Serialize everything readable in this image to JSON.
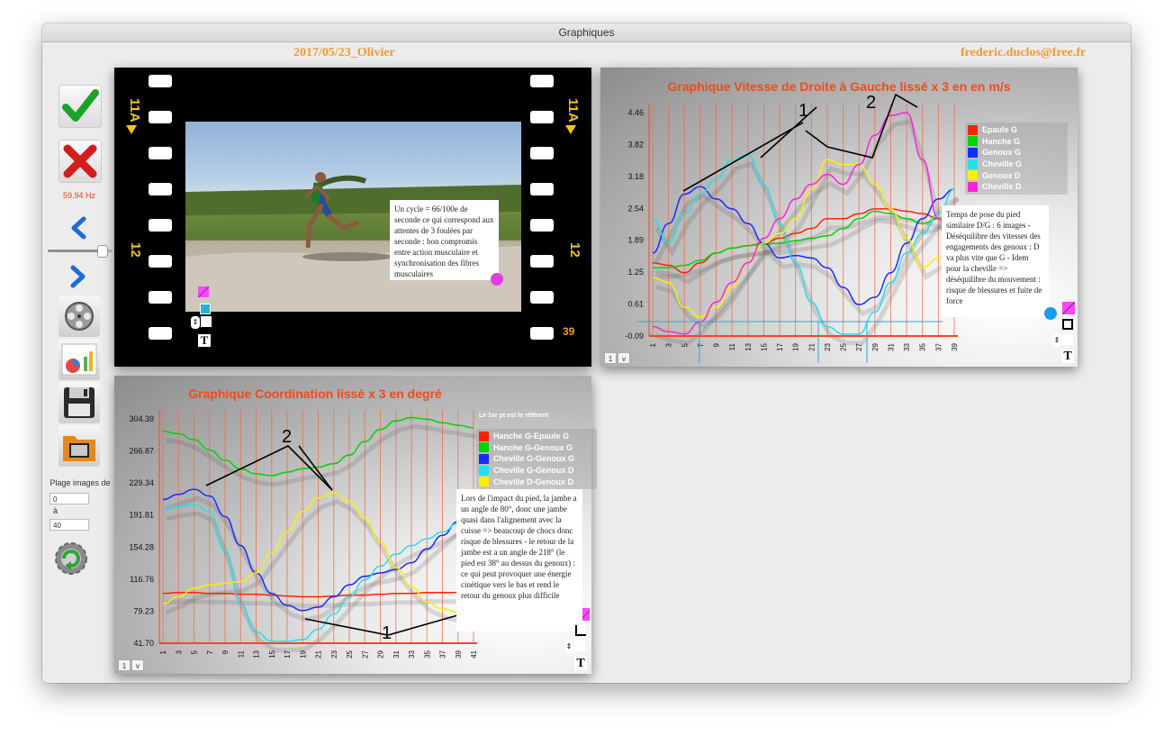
{
  "window": {
    "title": "Graphiques"
  },
  "header": {
    "left": "2017/05/23_Olivier",
    "right": "frederic.duclos@free.fr"
  },
  "sidebar": {
    "validate_icon": "checkmark-icon",
    "cancel_icon": "cross-icon",
    "frequency": "59.94 Hz",
    "slider_level": 0.9,
    "range_label": "Plage images de",
    "range_from": "0",
    "range_to_label": "à",
    "range_to": "40"
  },
  "video": {
    "film_code": "11A",
    "film_number": "12",
    "frame_number": "39",
    "note": "Un cycle = 66/100e de seconde ce qui correspond aux attentes de 3 foulées par seconde : bon compromis entre action musculaire et synchronisation des fibres musculaires"
  },
  "speed_panel": {
    "note": "Temps de pose du pied similaire D/G : 6 images -  Déséquilibre des vitesses des engagements des genoux : D va plus vite  que G -  Idem pour la cheville => déséquilibre du mouvement : risque de blessures et fuite de force",
    "annotations": [
      "1",
      "2"
    ],
    "btn1": "1",
    "btn2": "v"
  },
  "coord_panel": {
    "legend_header": "Le 1er pt est le référent",
    "note": "Lors de l'impact du pied, la jambe a un angle de 80°, donc une jambe quasi dans l'alignement avec la cuisse => beaucoup de chocs donc risque de blessures  -  le retour de la jambe est a un angle de 218° (le pied est 38° au dessus du genoux) : ce qui peut provoquer une énergie cinétique vers le bas et rend le retour du genoux plus difficile",
    "annotations": [
      "2",
      "1"
    ],
    "btn1": "1",
    "btn2": "v"
  },
  "chart_data": [
    {
      "type": "line",
      "title": "Graphique Vitesse de Droite à Gauche lissé x 3 en  en m/s",
      "x": [
        1,
        3,
        5,
        7,
        9,
        11,
        13,
        15,
        17,
        19,
        21,
        23,
        25,
        27,
        29,
        31,
        33,
        35,
        37,
        39
      ],
      "y_ticks": [
        "4.46",
        "3.82",
        "3.18",
        "2.54",
        "1.89",
        "1.25",
        "0.61",
        "-0.09"
      ],
      "ylim": [
        -0.09,
        4.46
      ],
      "series": [
        {
          "name": "Epaule G",
          "color": "#ff2200",
          "values": [
            1.4,
            1.35,
            1.2,
            1.4,
            1.6,
            1.7,
            1.75,
            1.8,
            1.9,
            2.0,
            2.1,
            2.3,
            2.3,
            2.4,
            2.5,
            2.5,
            2.45,
            2.4,
            2.3,
            2.5
          ]
        },
        {
          "name": "Hanche G",
          "color": "#00d400",
          "values": [
            1.3,
            1.3,
            1.35,
            1.45,
            1.6,
            1.7,
            1.75,
            1.78,
            1.8,
            1.85,
            1.9,
            1.95,
            2.1,
            2.3,
            2.45,
            2.4,
            2.3,
            2.2,
            2.3,
            2.5
          ]
        },
        {
          "name": "Genoux G",
          "color": "#1a2bff",
          "values": [
            1.6,
            2.2,
            2.8,
            2.95,
            2.7,
            2.5,
            2.2,
            1.8,
            1.5,
            1.55,
            1.5,
            1.3,
            0.9,
            0.55,
            0.7,
            1.2,
            1.8,
            2.3,
            2.7,
            2.9
          ]
        },
        {
          "name": "Cheville G",
          "color": "#22e0f0",
          "values": [
            2.3,
            1.8,
            2.4,
            2.8,
            3.1,
            3.5,
            3.6,
            3.0,
            2.2,
            1.4,
            0.6,
            0.1,
            -0.05,
            -0.05,
            0.4,
            1.0,
            1.6,
            2.0,
            2.4,
            2.9
          ]
        },
        {
          "name": "Genoux D",
          "color": "#ffee00",
          "values": [
            1.1,
            1.0,
            0.5,
            0.3,
            0.5,
            0.9,
            1.4,
            1.8,
            2.0,
            2.3,
            2.9,
            3.5,
            3.4,
            3.4,
            3.0,
            2.5,
            1.9,
            1.3,
            1.5,
            1.9
          ]
        },
        {
          "name": "Cheville D",
          "color": "#ff22dd",
          "values": [
            0.1,
            0.0,
            -0.05,
            0.2,
            0.6,
            1.0,
            1.4,
            1.9,
            2.3,
            2.7,
            3.0,
            3.2,
            3.0,
            3.4,
            4.0,
            4.4,
            4.46,
            3.5,
            2.3,
            1.5
          ]
        }
      ]
    },
    {
      "type": "line",
      "title": "Graphique Coordination lissé x 3 en degré",
      "x": [
        1,
        3,
        5,
        7,
        9,
        11,
        13,
        15,
        17,
        19,
        21,
        23,
        25,
        27,
        29,
        31,
        33,
        35,
        37,
        39,
        41
      ],
      "y_ticks": [
        "304.39",
        "266.87",
        "229.34",
        "191.81",
        "154.28",
        "116.76",
        "79.23",
        "41.70"
      ],
      "ylim": [
        41.7,
        304.39
      ],
      "series": [
        {
          "name": "Hanche G-Epaule G",
          "color": "#ff2200",
          "values": [
            100,
            101,
            101,
            100,
            100,
            99,
            99,
            98,
            97,
            96,
            96,
            97,
            98,
            98,
            99,
            100,
            100,
            101,
            101,
            101,
            101
          ]
        },
        {
          "name": "Hanche G-Genoux G",
          "color": "#00d400",
          "values": [
            290,
            287,
            280,
            268,
            256,
            246,
            240,
            238,
            242,
            246,
            248,
            252,
            262,
            278,
            292,
            302,
            306,
            304,
            300,
            297,
            294
          ]
        },
        {
          "name": "Cheville G-Genoux G",
          "color": "#1a2bff",
          "values": [
            210,
            216,
            222,
            214,
            190,
            156,
            124,
            100,
            86,
            80,
            84,
            96,
            110,
            120,
            124,
            128,
            136,
            152,
            168,
            184,
            198
          ]
        },
        {
          "name": "Cheville G-Genoux D",
          "color": "#22e0f0",
          "values": [
            198,
            202,
            204,
            196,
            150,
            88,
            55,
            44,
            44,
            46,
            58,
            76,
            96,
            116,
            132,
            146,
            156,
            164,
            172,
            182,
            194
          ]
        },
        {
          "name": "Cheville D-Genoux D",
          "color": "#ffee00",
          "values": [
            88,
            96,
            106,
            110,
            112,
            114,
            124,
            148,
            172,
            196,
            212,
            218,
            208,
            188,
            160,
            130,
            108,
            90,
            82,
            78,
            76
          ]
        }
      ]
    }
  ]
}
